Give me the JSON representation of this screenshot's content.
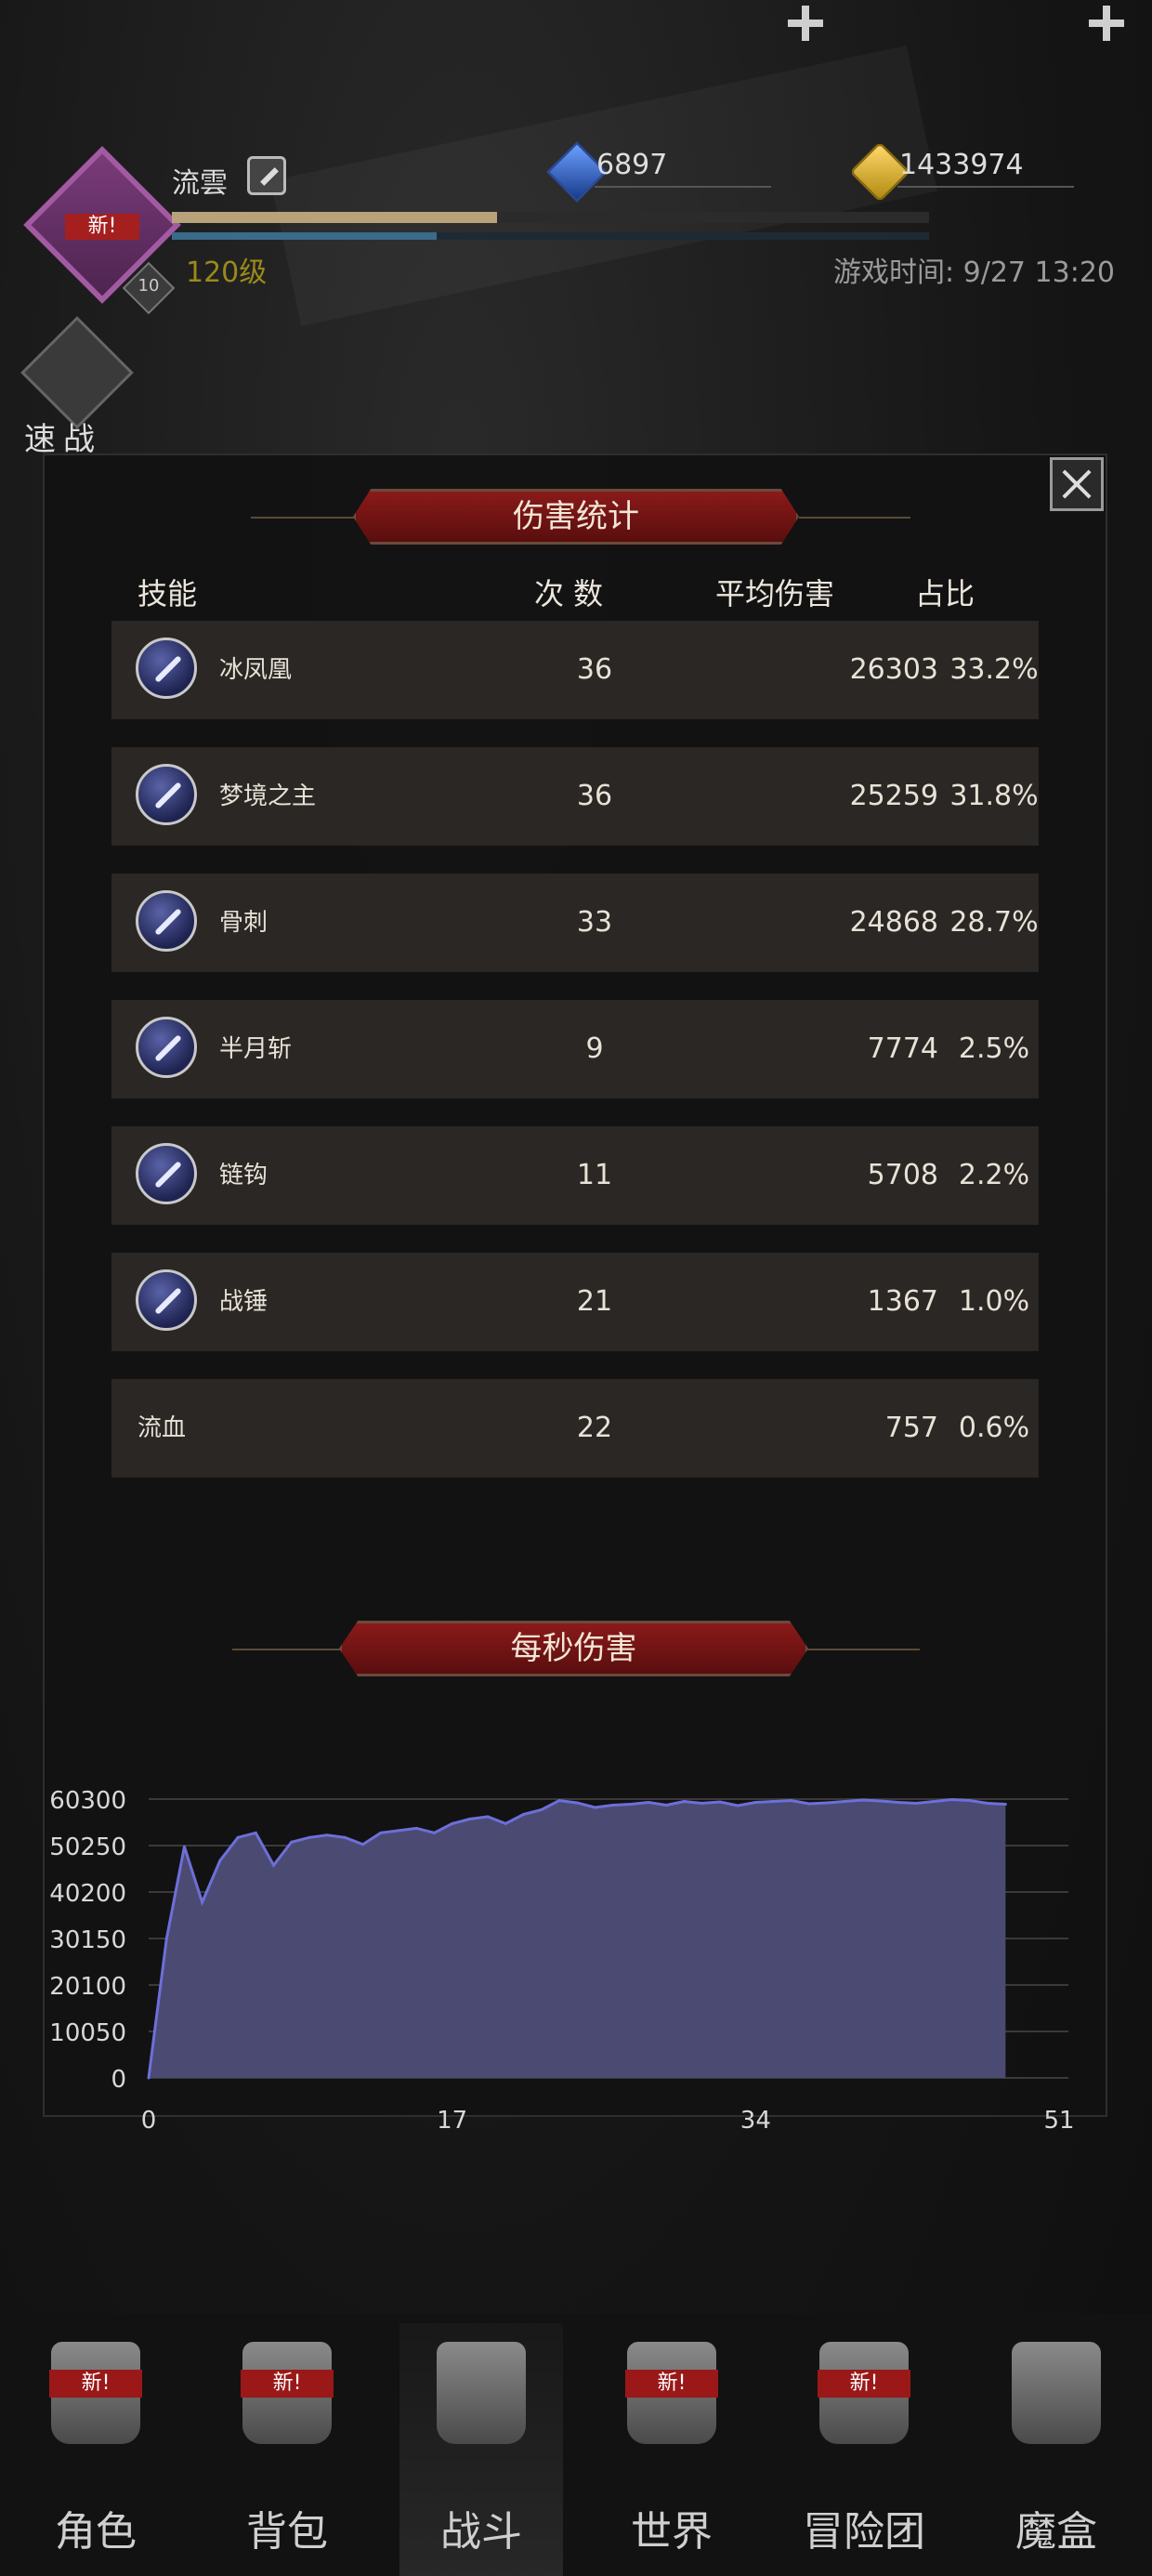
{
  "player": {
    "name": "流雲",
    "avatar_badge": "新!",
    "avatar_level": "10",
    "level": "120级",
    "exp_fraction": 0.43,
    "mp_fraction": 0.35
  },
  "currency": {
    "gems": "6897",
    "gold": "1433974"
  },
  "game_time": "游戏时间: 9/27 13:20",
  "quick_battle_label": "速战",
  "dialog": {
    "title": "伤害统计",
    "headers": {
      "skill": "技能",
      "count": "次 数",
      "avg_damage": "平均伤害",
      "ratio": "占比"
    },
    "rows": [
      {
        "skill": "冰凤凰",
        "count": "36",
        "avg": "26303",
        "pct": "33.2%",
        "icon": "ice-phoenix-icon"
      },
      {
        "skill": "梦境之主",
        "count": "36",
        "avg": "25259",
        "pct": "31.8%",
        "icon": "dream-lord-icon"
      },
      {
        "skill": "骨刺",
        "count": "33",
        "avg": "24868",
        "pct": "28.7%",
        "icon": "bone-spike-icon"
      },
      {
        "skill": "半月斩",
        "count": "9",
        "avg": "7774",
        "pct": "2.5%",
        "icon": "half-moon-slash-icon"
      },
      {
        "skill": "链钩",
        "count": "11",
        "avg": "5708",
        "pct": "2.2%",
        "icon": "chain-hook-icon"
      },
      {
        "skill": "战锤",
        "count": "21",
        "avg": "1367",
        "pct": "1.0%",
        "icon": "war-hammer-icon"
      },
      {
        "skill": "流血",
        "count": "22",
        "avg": "757",
        "pct": "0.6%",
        "icon": ""
      }
    ],
    "dps_title": "每秒伤害"
  },
  "chart_data": {
    "type": "area",
    "title": "每秒伤害",
    "x": [
      0,
      1,
      2,
      3,
      4,
      5,
      6,
      7,
      8,
      9,
      10,
      11,
      12,
      13,
      14,
      15,
      16,
      17,
      18,
      19,
      20,
      21,
      22,
      23,
      24,
      25,
      26,
      27,
      28,
      29,
      30,
      31,
      32,
      33,
      34,
      35,
      36,
      37,
      38,
      39,
      40,
      41,
      42,
      43,
      44,
      45,
      46,
      47,
      48
    ],
    "values": [
      0,
      30000,
      50000,
      38000,
      47000,
      52000,
      53000,
      46000,
      51000,
      52000,
      52500,
      52000,
      50500,
      53000,
      53500,
      54000,
      53000,
      55000,
      56000,
      56500,
      55000,
      57000,
      58000,
      60000,
      59500,
      58500,
      59000,
      59200,
      59600,
      59000,
      59800,
      59400,
      59700,
      58900,
      59600,
      59800,
      60000,
      59300,
      59500,
      59800,
      60100,
      59900,
      59600,
      59400,
      59800,
      60200,
      60000,
      59400,
      59200
    ],
    "xlim": [
      0,
      51
    ],
    "ylim": [
      0,
      60300
    ],
    "x_ticks": [
      "0",
      "17",
      "34",
      "51"
    ],
    "y_ticks": [
      "60300",
      "50250",
      "40200",
      "30150",
      "20100",
      "10050",
      "0"
    ],
    "fill_color": "#4b4a73",
    "line_color": "#6d6fd9",
    "grid": true
  },
  "nav": [
    {
      "label": "角色",
      "new": "新!",
      "icon": "character-icon"
    },
    {
      "label": "背包",
      "new": "新!",
      "icon": "backpack-icon"
    },
    {
      "label": "战斗",
      "new": "",
      "icon": "battle-shield-icon"
    },
    {
      "label": "世界",
      "new": "新!",
      "icon": "world-scroll-icon"
    },
    {
      "label": "冒险团",
      "new": "新!",
      "icon": "adventure-team-icon"
    },
    {
      "label": "魔盒",
      "new": "",
      "icon": "magic-box-icon"
    }
  ]
}
